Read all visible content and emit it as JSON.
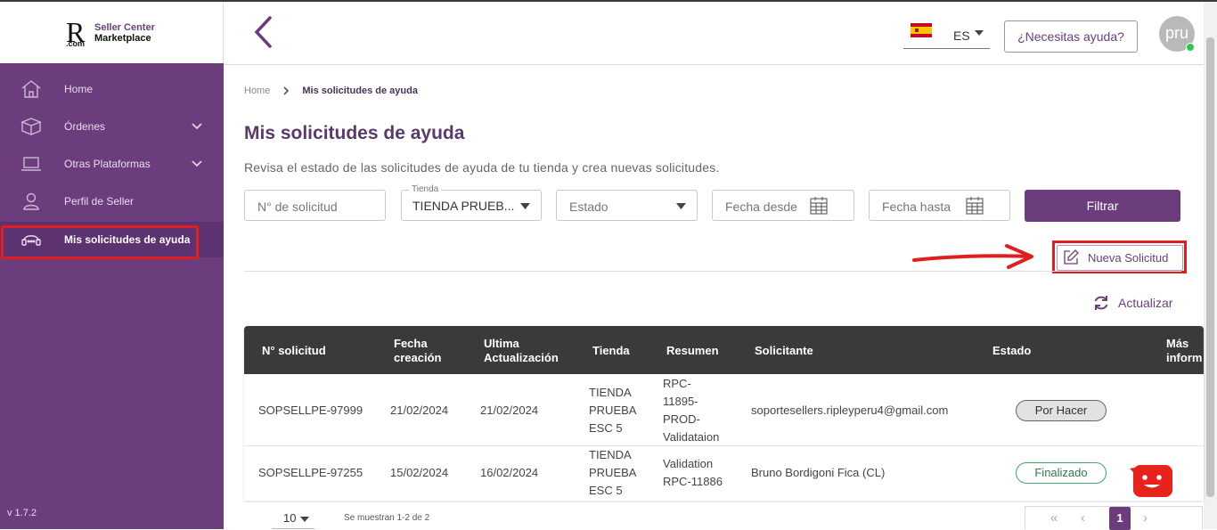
{
  "brand": {
    "logo_letter": "R",
    "logo_domain": ".com",
    "line1": "Seller Center",
    "line2": "Marketplace",
    "accent": "#6b3d7d"
  },
  "sidebar": {
    "items": [
      {
        "label": "Home",
        "icon": "home-icon"
      },
      {
        "label": "Órdenes",
        "icon": "box-icon"
      },
      {
        "label": "Otras Plataformas",
        "icon": "laptop-icon"
      },
      {
        "label": "Perfil de Seller",
        "icon": "user-icon"
      },
      {
        "label": "Mis solicitudes de ayuda",
        "icon": "headset-icon"
      }
    ],
    "version": "v 1.7.2"
  },
  "header": {
    "language": "ES",
    "help_label": "¿Necesitas ayuda?",
    "avatar_text": "pru"
  },
  "breadcrumb": {
    "home": "Home",
    "current": "Mis solicitudes de ayuda"
  },
  "page": {
    "title": "Mis solicitudes de ayuda",
    "subtitle": "Revisa el estado de las solicitudes de ayuda de tu tienda y crea nuevas solicitudes."
  },
  "filters": {
    "request_placeholder": "N° de solicitud",
    "store_label": "Tienda",
    "store_value": "TIENDA PRUEB...",
    "status_placeholder": "Estado",
    "date_from_placeholder": "Fecha desde",
    "date_to_placeholder": "Fecha hasta",
    "filter_button": "Filtrar"
  },
  "actions": {
    "new_request": "Nueva Solicitud",
    "refresh": "Actualizar"
  },
  "table": {
    "headers": {
      "id": "N° solicitud",
      "created_1": "Fecha",
      "created_2": "creación",
      "updated_1": "Ultima",
      "updated_2": "Actualización",
      "store": "Tienda",
      "summary": "Resumen",
      "requester": "Solicitante",
      "status": "Estado",
      "more_1": "Más",
      "more_2": "inform"
    },
    "rows": [
      {
        "id": "SOPSELLPE-97999",
        "created": "21/02/2024",
        "updated": "21/02/2024",
        "store": [
          "TIENDA",
          "PRUEBA",
          "ESC 5"
        ],
        "summary": [
          "RPC-",
          "11895-",
          "PROD-",
          "Validataion"
        ],
        "requester": "soportesellers.ripleyperu4@gmail.com",
        "status": "Por Hacer"
      },
      {
        "id": "SOPSELLPE-97255",
        "created": "15/02/2024",
        "updated": "16/02/2024",
        "store": [
          "TIENDA",
          "PRUEBA",
          "ESC 5"
        ],
        "summary": [
          "Validation",
          "RPC-11886"
        ],
        "requester": "Bruno Bordigoni Fica (CL)",
        "status": "Finalizado"
      }
    ]
  },
  "pagination": {
    "page_size": "10",
    "info": "Se muestran 1-2 de 2",
    "current_page": "1"
  }
}
